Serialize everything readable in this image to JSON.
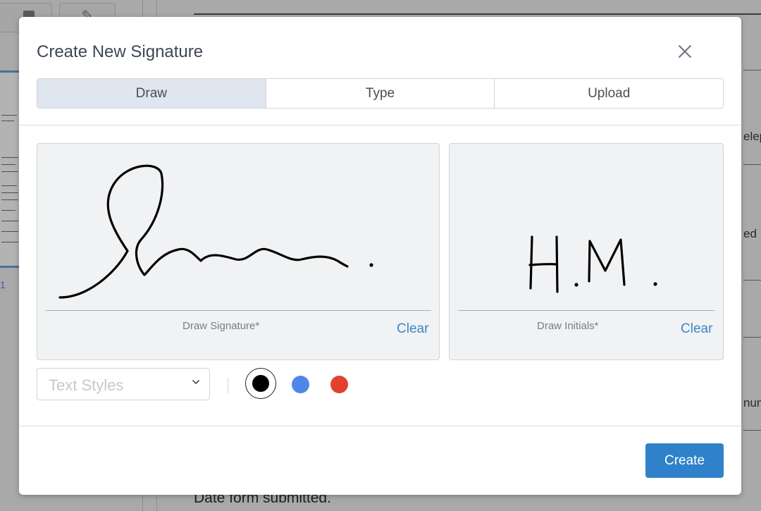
{
  "background": {
    "side_words": [
      "elep",
      "ed",
      "num"
    ],
    "footer_text": "Date form submitted."
  },
  "dialog": {
    "title": "Create New Signature",
    "close_icon": "close-icon",
    "tabs": [
      {
        "label": "Draw",
        "active": true
      },
      {
        "label": "Type",
        "active": false
      },
      {
        "label": "Upload",
        "active": false
      }
    ],
    "signature_pad": {
      "label": "Draw Signature*",
      "clear_label": "Clear"
    },
    "initials_pad": {
      "label": "Draw Initials*",
      "clear_label": "Clear"
    },
    "text_styles": {
      "placeholder": "Text Styles",
      "icon": "chevron-down-icon"
    },
    "ink_colors": [
      {
        "name": "black",
        "hex": "#000000",
        "selected": true
      },
      {
        "name": "blue",
        "hex": "#4f86ea",
        "selected": false
      },
      {
        "name": "red",
        "hex": "#e2412f",
        "selected": false
      }
    ],
    "create_label": "Create"
  },
  "colors": {
    "accent": "#2f82c9",
    "active_tab": "#dfe6ef"
  }
}
